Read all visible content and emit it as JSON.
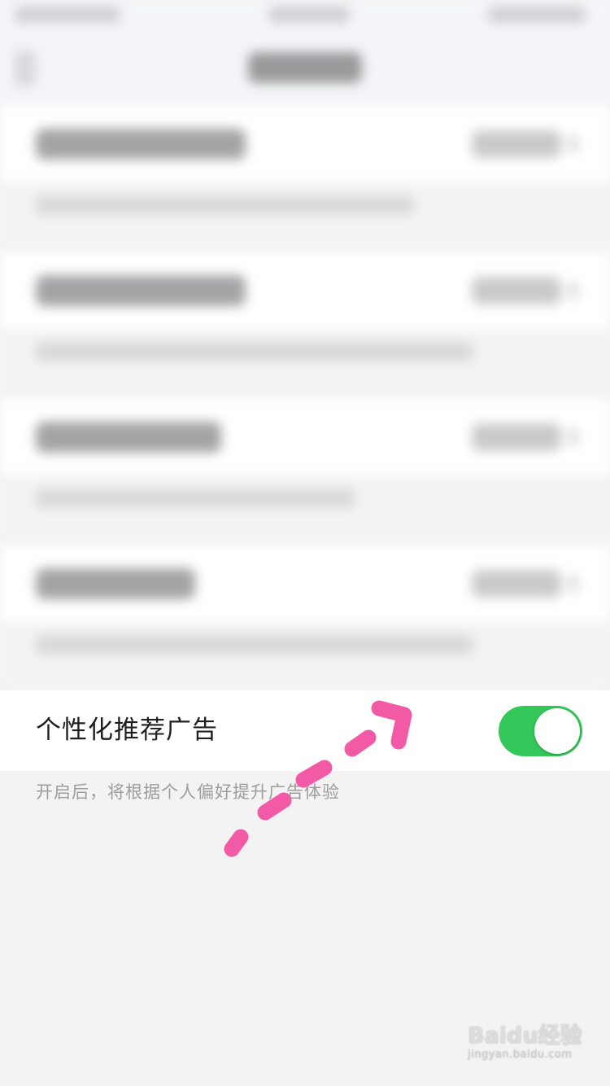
{
  "personalized_ad": {
    "label": "个性化推荐广告",
    "enabled": true,
    "description": "开启后，将根据个人偏好提升广告体验"
  },
  "colors": {
    "toggle_on": "#34c759",
    "annotation_arrow": "#f35aa6"
  },
  "watermark": {
    "brand": "Baidu经验",
    "url": "jingyan.baidu.com"
  }
}
